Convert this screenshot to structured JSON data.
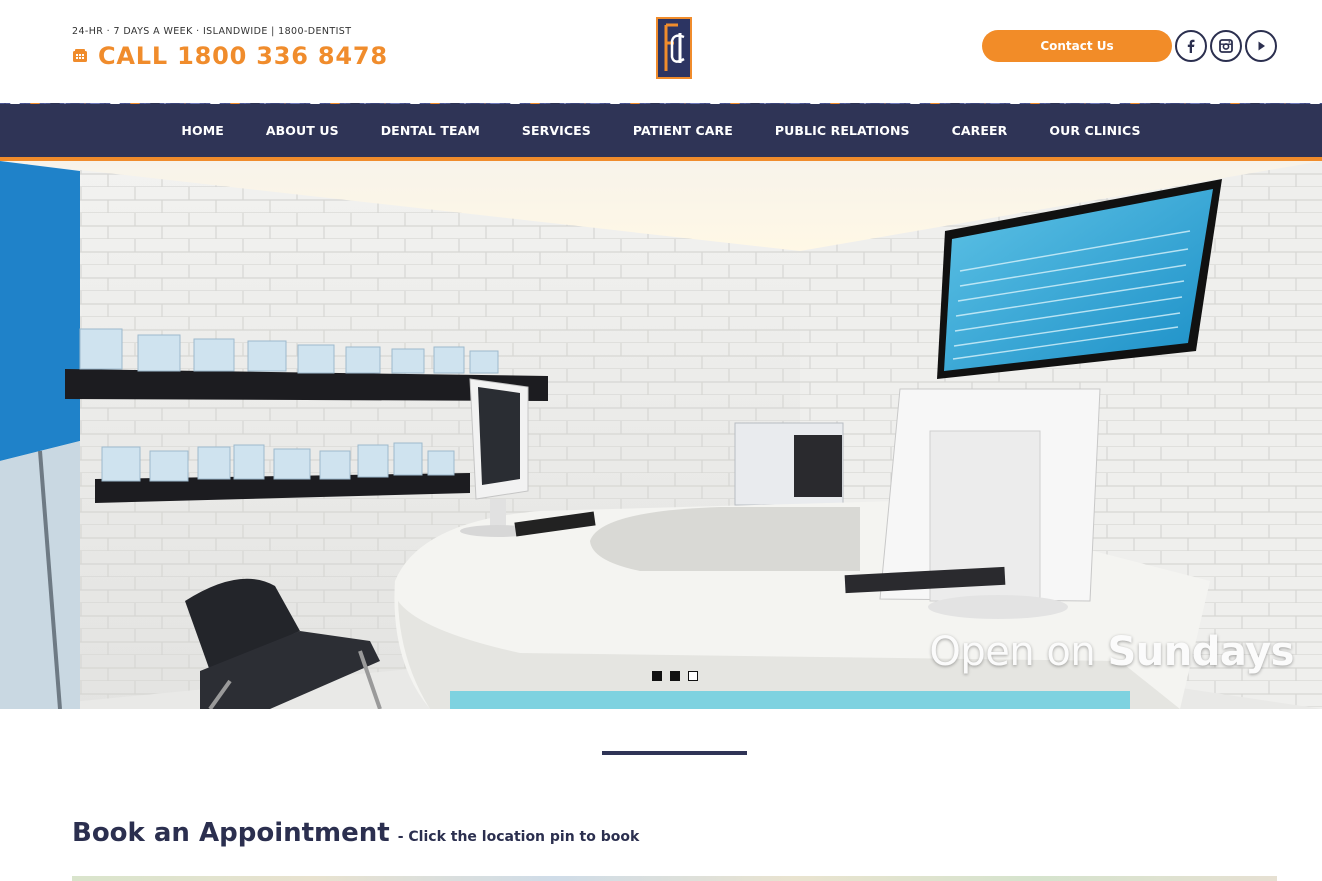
{
  "header": {
    "tagline": "24-HR · 7 DAYS A WEEK · ISLANDWIDE | 1800-DENTIST",
    "call_text": "CALL 1800 336 8478",
    "contact_button": "Contact Us",
    "logo_text": "fdc",
    "social": [
      "facebook-icon",
      "instagram-icon",
      "youtube-icon"
    ]
  },
  "nav": {
    "items": [
      "HOME",
      "ABOUT US",
      "DENTAL TEAM",
      "SERVICES",
      "PATIENT CARE",
      "PUBLIC RELATIONS",
      "CAREER",
      "OUR CLINICS"
    ]
  },
  "hero": {
    "caption_light": "Open on ",
    "caption_bold": "Sundays",
    "slides_count": 3,
    "active_slide": 3
  },
  "booking": {
    "title": "Book an Appointment",
    "subtitle": "- Click the location pin to book"
  },
  "colors": {
    "accent": "#f08c2c",
    "navy": "#2f3456",
    "text": "#2b2f4f"
  }
}
